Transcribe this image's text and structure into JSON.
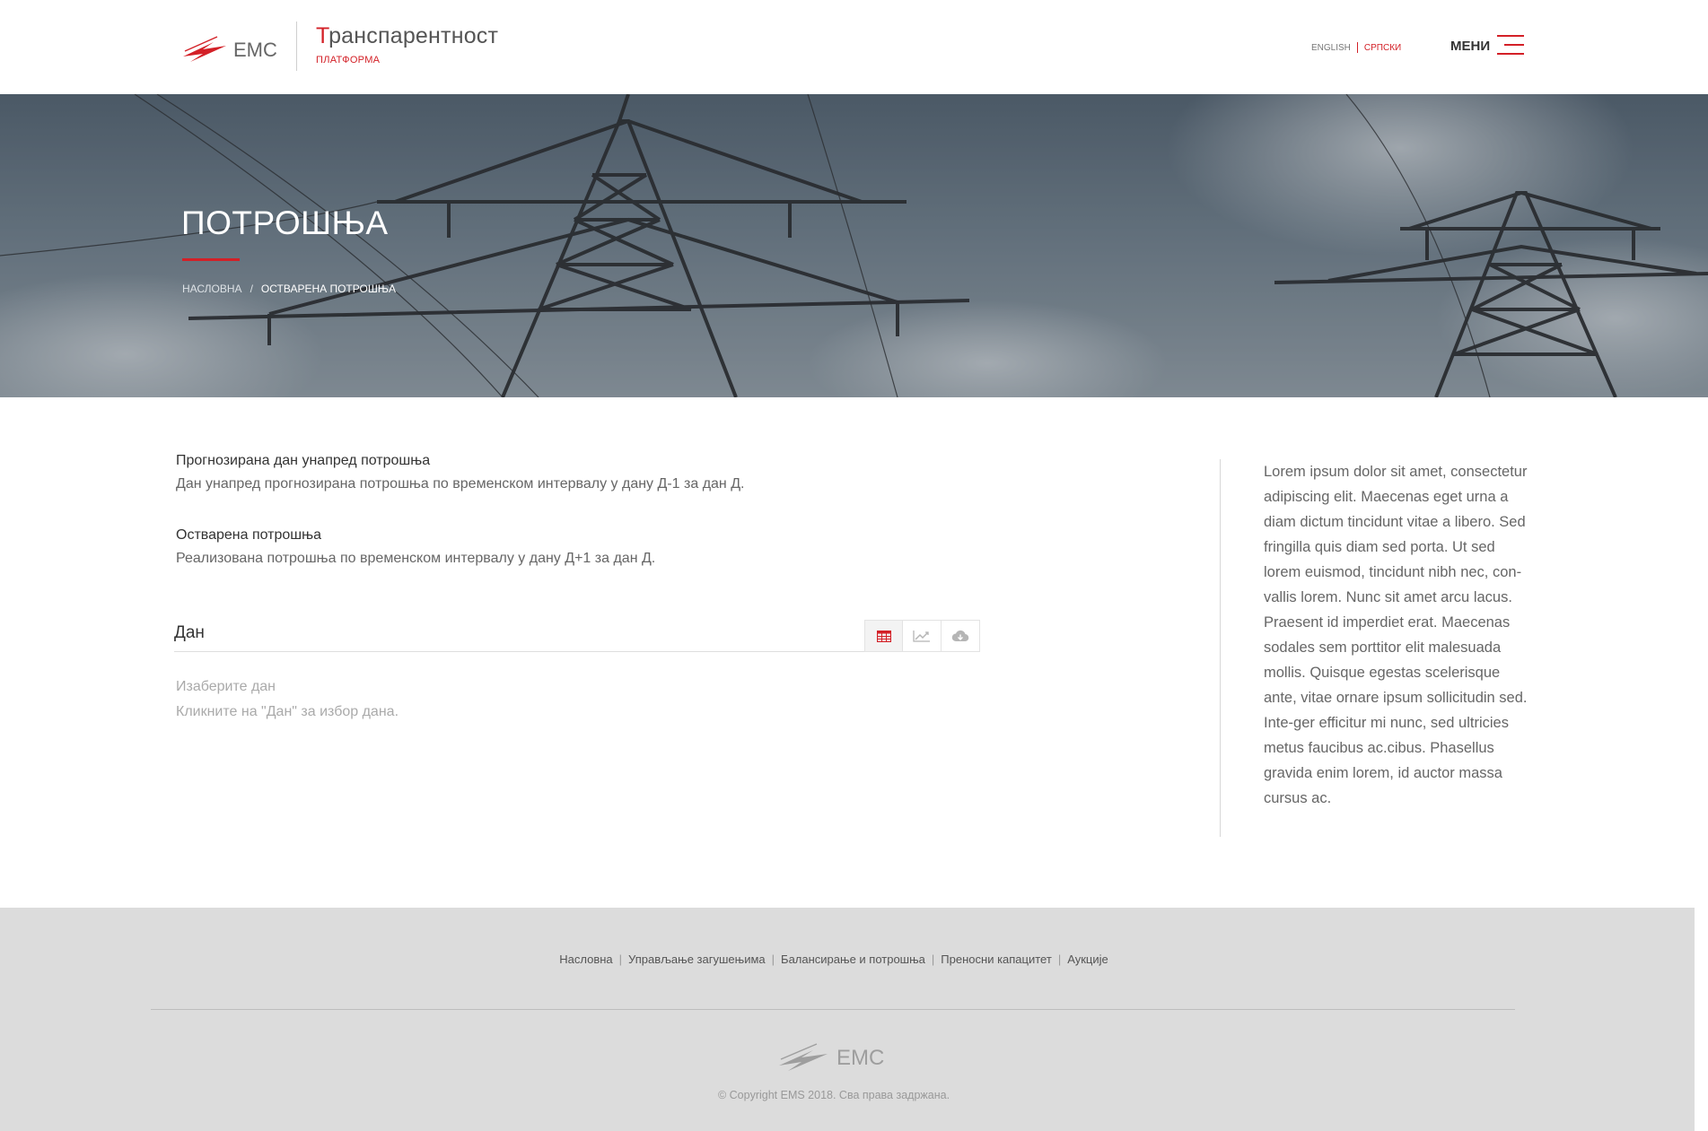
{
  "header": {
    "logo_text": "EMC",
    "brand_first_letter": "Т",
    "brand_rest": "ранспарентност",
    "brand_subtitle": "ПЛАТФОРМА",
    "lang_english": "ENGLISH",
    "lang_serbian": "СРПСКИ",
    "menu_label": "МЕНИ"
  },
  "hero": {
    "title": "ПОТРОШЊА",
    "breadcrumb_home": "НАСЛОВНА",
    "breadcrumb_sep": "/",
    "breadcrumb_current": "ОСТВАРЕНА ПОТРОШЊА"
  },
  "main": {
    "sections": [
      {
        "title": "Прогнозирана дан унапред потрошња",
        "text": "Дан унапред прогнозирана потрошња по временском интервалу у дану Д-1 за дан Д."
      },
      {
        "title": "Остварена потрошња",
        "text": "Реализована потрошња по временском интервалу у дану Д+1 за дан Д."
      }
    ],
    "day_label": "Дан",
    "hint_title": "Изаберите дан",
    "hint_text": "Кликните на \"Дан\" за избор дана."
  },
  "sidebar": {
    "text": "Lorem ipsum dolor sit amet, consectetur adipiscing elit. Maecenas eget urna a diam dictum tincidunt vitae a libero. Sed fringilla quis diam sed porta. Ut sed lorem euismod, tincidunt nibh nec, con-vallis lorem. Nunc sit amet arcu lacus. Praesent id imperdiet erat. Maecenas sodales sem porttitor elit malesuada mollis. Quisque egestas scelerisque ante, vitae ornare ipsum sollicitudin sed. Inte-ger efficitur mi nunc, sed ultricies metus faucibus ac.cibus. Phasellus gravida enim lorem, id auctor massa cursus ac."
  },
  "footer": {
    "nav": [
      "Насловна",
      "Управљање загушењима",
      "Балансирање и потрошња",
      "Преносни капацитет",
      "Аукције"
    ],
    "nav_sep": "|",
    "logo_text": "EMC",
    "copyright": "© Copyright EMS 2018. Сва права задржана."
  },
  "colors": {
    "accent": "#d32027",
    "footer_bg": "#dcdcdc"
  },
  "icons": [
    "bolt-logo-icon",
    "hamburger-icon",
    "table-icon",
    "line-chart-icon",
    "cloud-download-icon"
  ]
}
